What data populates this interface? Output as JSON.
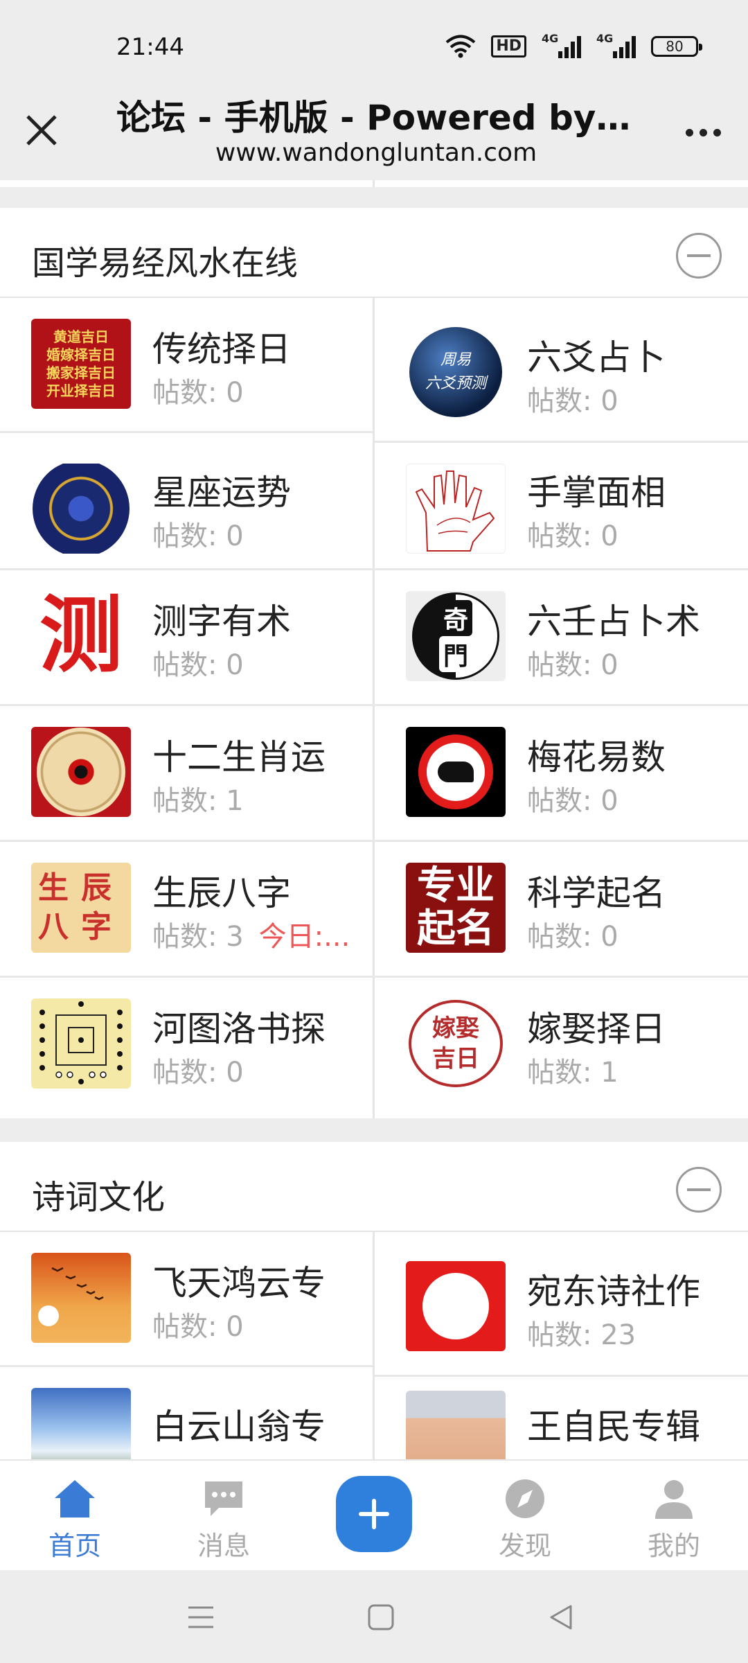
{
  "status_bar": {
    "time": "21:44",
    "hd_label": "HD",
    "network_1": "4G",
    "network_2": "4G",
    "battery": "80",
    "icons": [
      "wifi-icon",
      "hd-icon",
      "signal-icon",
      "signal-icon",
      "battery-icon"
    ]
  },
  "title_bar": {
    "title": "论坛 - 手机版 - Powered by Di...",
    "url": "www.wandongluntan.com",
    "close_icon": "close-icon",
    "more_icon": "more-icon"
  },
  "sections": [
    {
      "title": "国学易经风水在线",
      "forums": [
        {
          "name": "传统择日",
          "posts": "帖数: 0",
          "thumb_lines": [
            "黄道吉日",
            "婚嫁择吉日",
            "搬家择吉日",
            "开业择吉日"
          ]
        },
        {
          "name": "六爻占卜",
          "posts": "帖数: 0",
          "thumb_lines": [
            "周易",
            "六爻预测"
          ]
        },
        {
          "name": "星座运势",
          "posts": "帖数: 0"
        },
        {
          "name": "手掌面相",
          "posts": "帖数: 0"
        },
        {
          "name": "测字有术",
          "posts": "帖数: 0",
          "thumb_text": "测"
        },
        {
          "name": "六壬占卜术",
          "posts": "帖数: 0",
          "thumb_lines": [
            "奇",
            "門"
          ]
        },
        {
          "name": "十二生肖运",
          "posts": "帖数: 1"
        },
        {
          "name": "梅花易数",
          "posts": "帖数: 0"
        },
        {
          "name": "生辰八字",
          "posts": "帖数: 3",
          "today": "今日:...",
          "thumb_lines": [
            "生辰",
            "八字"
          ]
        },
        {
          "name": "科学起名",
          "posts": "帖数: 0",
          "thumb_lines": [
            "专业",
            "起名"
          ]
        },
        {
          "name": "河图洛书探",
          "posts": "帖数: 0"
        },
        {
          "name": "嫁娶择日",
          "posts": "帖数: 1",
          "thumb_lines": [
            "嫁娶",
            "吉日"
          ]
        }
      ]
    },
    {
      "title": "诗词文化",
      "forums": [
        {
          "name": "飞天鸿云专",
          "posts": "帖数: 0"
        },
        {
          "name": "宛东诗社作",
          "posts": "帖数: 23"
        },
        {
          "name": "白云山翁专",
          "posts": ""
        },
        {
          "name": "王自民专辑",
          "posts": ""
        }
      ]
    }
  ],
  "bottom_nav": {
    "items": [
      {
        "label": "首页",
        "icon": "home-icon",
        "active": true
      },
      {
        "label": "消息",
        "icon": "message-icon",
        "active": false
      },
      {
        "label": "",
        "icon": "plus-icon",
        "active": false
      },
      {
        "label": "发现",
        "icon": "compass-icon",
        "active": false
      },
      {
        "label": "我的",
        "icon": "user-icon",
        "active": false
      }
    ]
  },
  "system_nav": [
    "menu-icon",
    "home-square-icon",
    "back-icon"
  ],
  "colors": {
    "accent": "#3a7bd5",
    "fab": "#2f7fdc",
    "today_red": "#e55555",
    "muted": "#aaaaaa",
    "background": "#ededed"
  }
}
